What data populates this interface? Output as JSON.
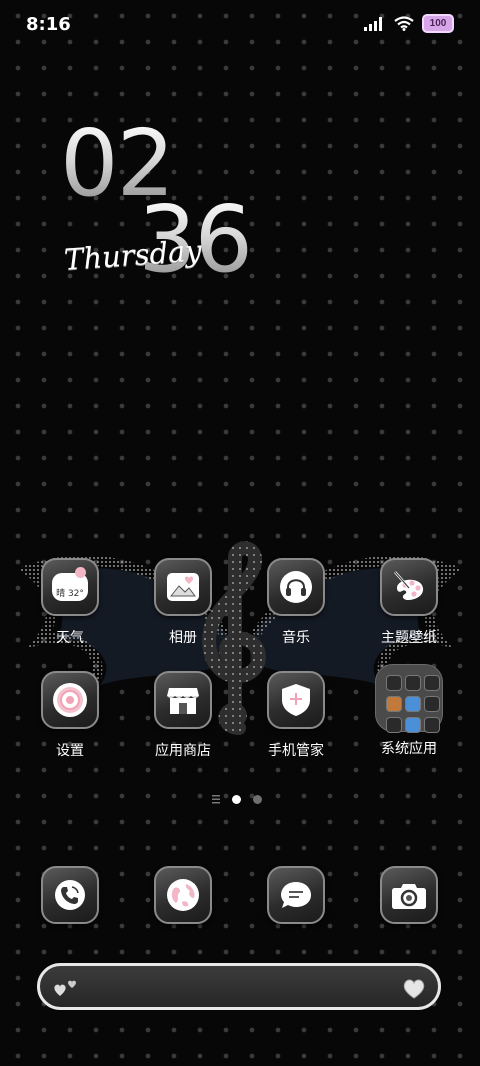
{
  "status_bar": {
    "time": "8:16",
    "battery": "100",
    "icons": [
      "signal-icon",
      "wifi-icon",
      "battery-icon"
    ]
  },
  "clock_widget": {
    "hour": "02",
    "minute": "36",
    "weekday": "Thursday"
  },
  "home_apps": [
    {
      "label": "天气",
      "icon": "weather-icon",
      "weather_text": "晴 32°"
    },
    {
      "label": "相册",
      "icon": "gallery-icon"
    },
    {
      "label": "音乐",
      "icon": "headphones-icon"
    },
    {
      "label": "主题壁纸",
      "icon": "palette-icon"
    },
    {
      "label": "设置",
      "icon": "settings-flower-icon"
    },
    {
      "label": "应用商店",
      "icon": "store-icon"
    },
    {
      "label": "手机管家",
      "icon": "shield-icon"
    },
    {
      "label": "系统应用",
      "icon": "folder-icon"
    }
  ],
  "page_indicator": {
    "pages": 2,
    "current": 1
  },
  "dock": [
    {
      "icon": "phone-icon"
    },
    {
      "icon": "browser-icon"
    },
    {
      "icon": "messages-icon"
    },
    {
      "icon": "camera-icon"
    }
  ],
  "colors": {
    "accent_pink": "#f2b6c6",
    "background": "#070707"
  }
}
